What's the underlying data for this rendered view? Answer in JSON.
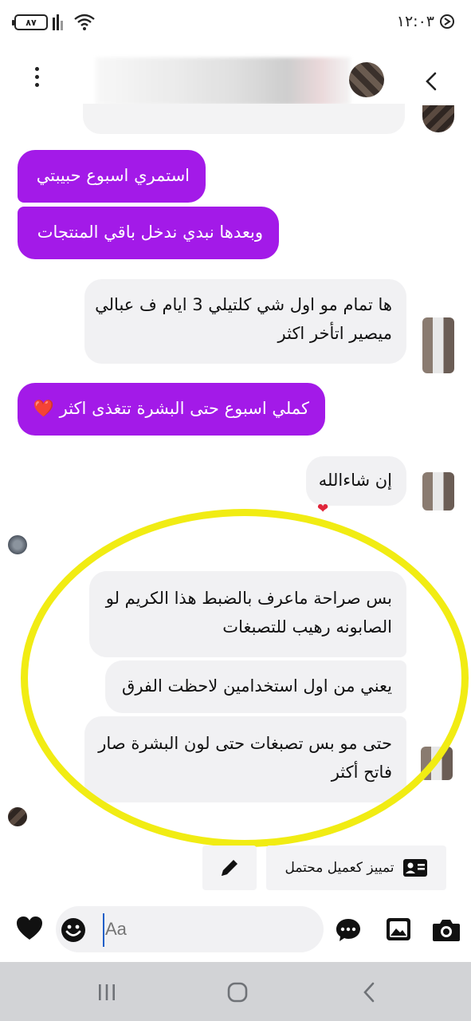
{
  "status_bar": {
    "battery": "٨٧",
    "time": "١٢:٠٣"
  },
  "header": {
    "contact_name_blurred": "...2375..."
  },
  "messages": [
    {
      "from": "me",
      "text": "استمري اسبوع حبيبتي"
    },
    {
      "from": "me",
      "text": "وبعدها نبدي ندخل باقي المنتجات"
    },
    {
      "from": "them",
      "lines": [
        "ها تمام مو اول شي كلتيلي 3 ايام ف عبالي",
        "ميصير اتأخر اكثر"
      ]
    },
    {
      "from": "me",
      "text": "كملي اسبوع حتى البشرة تتغذى اكثر ❤️"
    },
    {
      "from": "them",
      "text": "إن شاءالله",
      "reaction": "❤"
    },
    {
      "from": "them",
      "lines": [
        "بس صراحة ماعرف بالضبط هذا الكريم لو",
        "الصابونه رهيب للتصبغات"
      ]
    },
    {
      "from": "them",
      "text": "يعني من اول استخدامين لاحظت الفرق"
    },
    {
      "from": "them",
      "lines": [
        "حتى مو بس تصبغات حتى لون البشرة صار",
        "فاتح أكثر"
      ]
    }
  ],
  "quick_actions": {
    "potential_customer_label": "تمييز كعميل محتمل"
  },
  "composer": {
    "placeholder": "Aa"
  },
  "colors": {
    "my_bubble": "#a31ae8",
    "their_bubble": "#f1f1f3",
    "highlight": "#f1ec13"
  }
}
